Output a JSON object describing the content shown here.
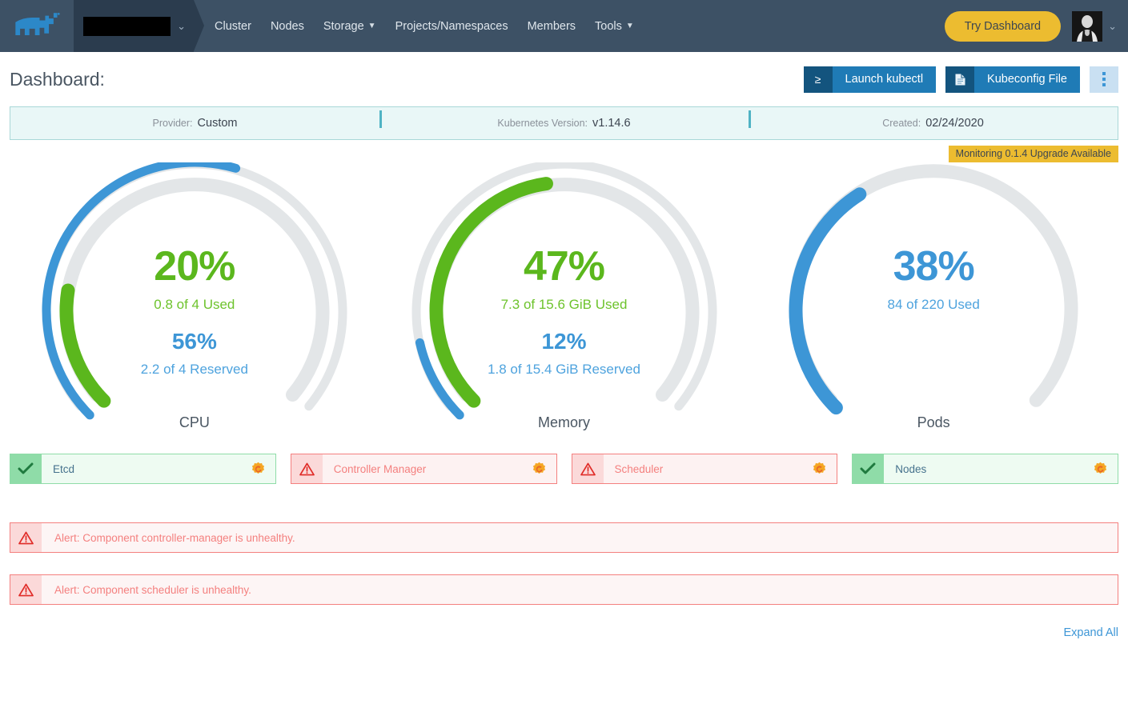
{
  "topnav": {
    "logo_name": "rancher-logo",
    "cluster_selector": {
      "value": "",
      "redacted": true,
      "chevron": "⌄"
    },
    "links": [
      {
        "label": "Cluster",
        "has_dropdown": false
      },
      {
        "label": "Nodes",
        "has_dropdown": false
      },
      {
        "label": "Storage",
        "has_dropdown": true
      },
      {
        "label": "Projects/Namespaces",
        "has_dropdown": false
      },
      {
        "label": "Members",
        "has_dropdown": false
      },
      {
        "label": "Tools",
        "has_dropdown": true
      }
    ],
    "try_dashboard_label": "Try Dashboard",
    "avatar_chevron": "⌄",
    "colors": {
      "bar_bg": "#3d5165",
      "select_bg": "#2b3c4e",
      "try_dashboard_bg": "#ecbc30"
    }
  },
  "page": {
    "title": "Dashboard:",
    "actions": {
      "launch_kubectl": {
        "label": "Launch kubectl",
        "icon": "≥"
      },
      "kubeconfig_file": {
        "label": "Kubeconfig File",
        "icon": "file-icon"
      },
      "kebab": "more-actions"
    }
  },
  "infobar": [
    {
      "label": "Provider:",
      "value": "Custom"
    },
    {
      "label": "Kubernetes Version:",
      "value": "v1.14.6"
    },
    {
      "label": "Created:",
      "value": "02/24/2020"
    }
  ],
  "monitoring_banner": "Monitoring 0.1.4 Upgrade Available",
  "chart_data": [
    {
      "type": "gauge",
      "title": "CPU",
      "series": [
        {
          "name": "Reserved",
          "percent": 56,
          "detail": "2.2 of 4 Reserved",
          "value": 2.2,
          "max": 4,
          "color": "#3d96d6",
          "ring": "outer"
        },
        {
          "name": "Used",
          "percent": 20,
          "detail": "0.8 of 4 Used",
          "value": 0.8,
          "max": 4,
          "color": "#5bb71d",
          "ring": "inner"
        }
      ],
      "primary_percent": "20%",
      "primary_detail": "0.8 of 4 Used",
      "secondary_percent": "56%",
      "secondary_detail": "2.2 of 4 Reserved",
      "ylim": [
        0,
        100
      ]
    },
    {
      "type": "gauge",
      "title": "Memory",
      "series": [
        {
          "name": "Reserved",
          "percent": 12,
          "detail": "1.8 of 15.4 GiB Reserved",
          "value": 1.8,
          "max": 15.4,
          "color": "#3d96d6",
          "ring": "outer"
        },
        {
          "name": "Used",
          "percent": 47,
          "detail": "7.3 of 15.6 GiB Used",
          "value": 7.3,
          "max": 15.6,
          "color": "#5bb71d",
          "ring": "inner"
        }
      ],
      "primary_percent": "47%",
      "primary_detail": "7.3 of 15.6 GiB Used",
      "secondary_percent": "12%",
      "secondary_detail": "1.8 of 15.4 GiB Reserved",
      "ylim": [
        0,
        100
      ]
    },
    {
      "type": "gauge",
      "title": "Pods",
      "series": [
        {
          "name": "Used",
          "percent": 38,
          "detail": "84 of 220 Used",
          "value": 84,
          "max": 220,
          "color": "#3d96d6",
          "ring": "single"
        }
      ],
      "primary_percent": "38%",
      "primary_detail": "84 of 220 Used",
      "secondary_percent": "",
      "secondary_detail": "",
      "ylim": [
        0,
        100
      ]
    }
  ],
  "components": [
    {
      "label": "Etcd",
      "status": "ok",
      "status_icon": "check-icon",
      "action_icon": "grafana-icon"
    },
    {
      "label": "Controller Manager",
      "status": "err",
      "status_icon": "warning-triangle-icon",
      "action_icon": "grafana-icon"
    },
    {
      "label": "Scheduler",
      "status": "err",
      "status_icon": "warning-triangle-icon",
      "action_icon": "grafana-icon"
    },
    {
      "label": "Nodes",
      "status": "ok",
      "status_icon": "check-icon",
      "action_icon": "grafana-icon"
    }
  ],
  "alerts": [
    {
      "text": "Alert: Component controller-manager is unhealthy.",
      "icon": "warning-triangle-icon"
    },
    {
      "text": "Alert: Component scheduler is unhealthy.",
      "icon": "warning-triangle-icon"
    }
  ],
  "expand_all_label": "Expand All"
}
